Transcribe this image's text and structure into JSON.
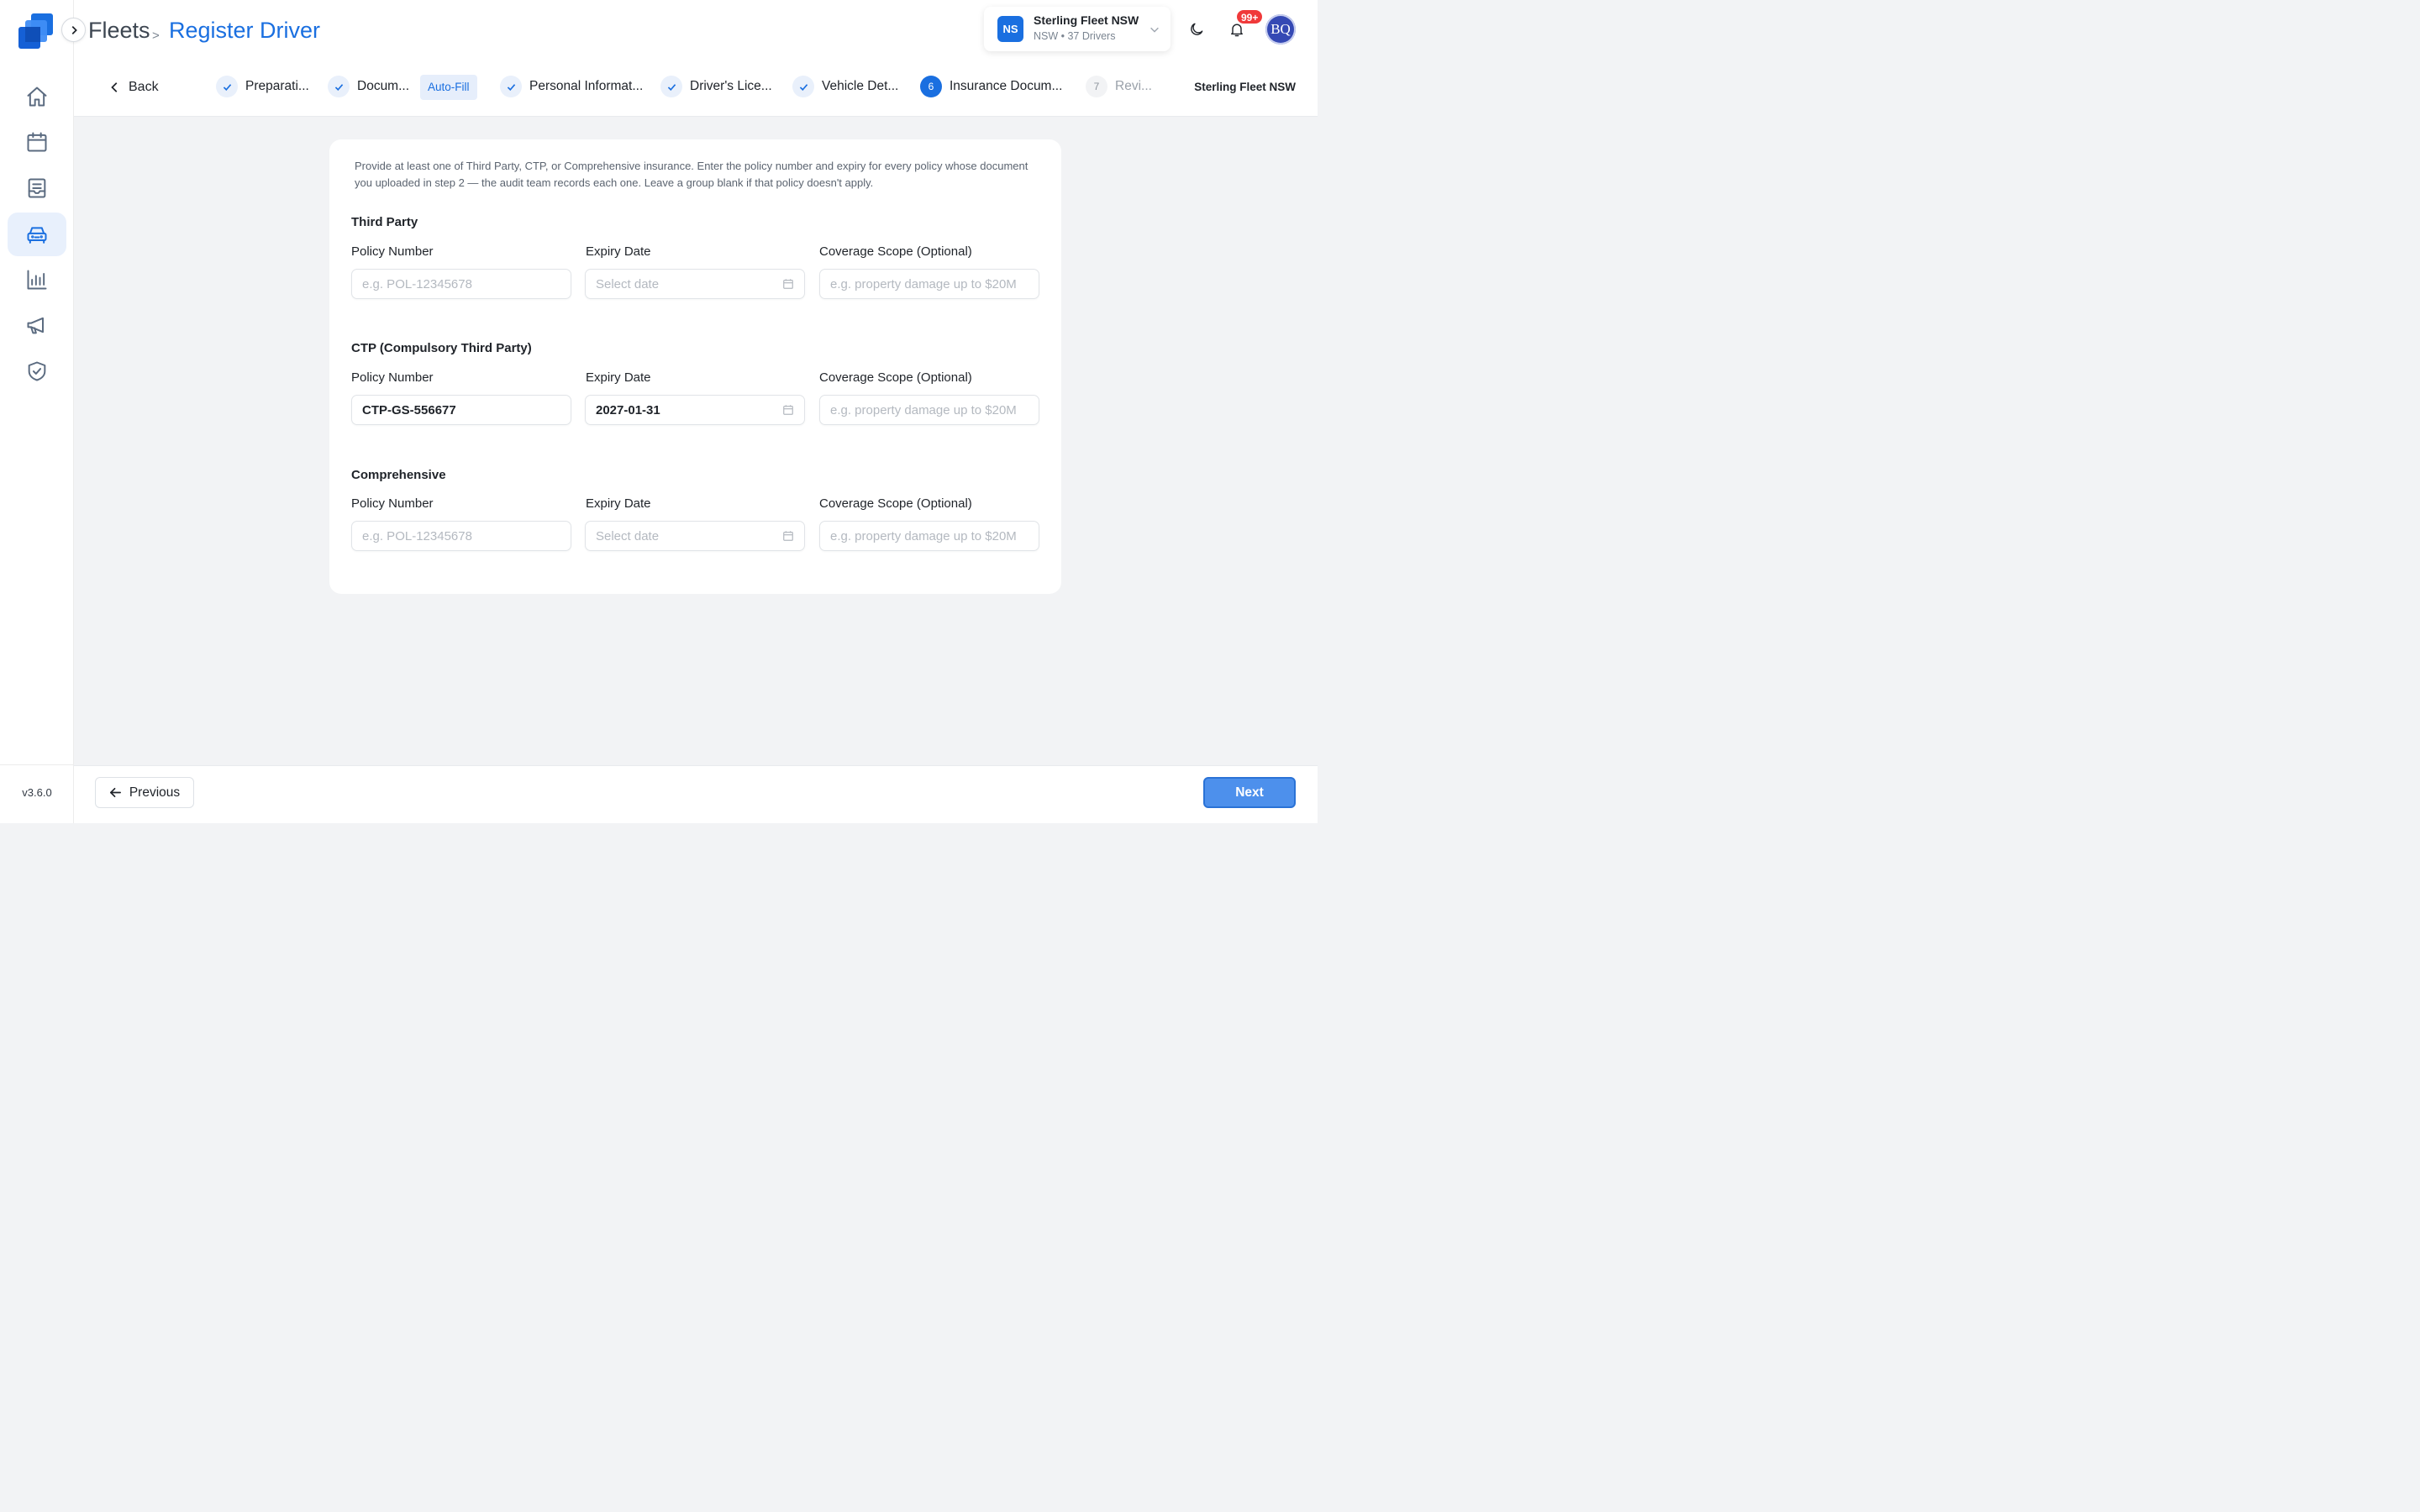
{
  "app": {
    "version": "v3.6.0",
    "accent_color": "#1a6fe0"
  },
  "sidebar": {
    "items": [
      {
        "name": "home",
        "icon": "home-icon",
        "active": false
      },
      {
        "name": "calendar",
        "icon": "calendar-icon",
        "active": false
      },
      {
        "name": "documents",
        "icon": "document-tray-icon",
        "active": false
      },
      {
        "name": "fleets",
        "icon": "car-icon",
        "active": true
      },
      {
        "name": "analytics",
        "icon": "bar-chart-icon",
        "active": false
      },
      {
        "name": "announcements",
        "icon": "megaphone-icon",
        "active": false
      },
      {
        "name": "compliance",
        "icon": "shield-check-icon",
        "active": false
      }
    ]
  },
  "header": {
    "breadcrumb_root": "Fleets",
    "breadcrumb_separator": ">",
    "breadcrumb_current": "Register Driver",
    "fleet_switcher": {
      "initials": "NS",
      "name": "Sterling Fleet NSW",
      "subtitle": "NSW • 37 Drivers"
    },
    "notifications_badge": "99+",
    "user_initials": "BQ"
  },
  "stepper": {
    "back_label": "Back",
    "autofill_label": "Auto-Fill",
    "fleet_label": "Sterling Fleet NSW",
    "steps": [
      {
        "number": "1",
        "label": "Preparati...",
        "state": "done"
      },
      {
        "number": "2",
        "label": "Docum...",
        "state": "done"
      },
      {
        "number": "3",
        "label": "Personal Informat...",
        "state": "done"
      },
      {
        "number": "4",
        "label": "Driver's Lice...",
        "state": "done"
      },
      {
        "number": "5",
        "label": "Vehicle Det...",
        "state": "done"
      },
      {
        "number": "6",
        "label": "Insurance Docum...",
        "state": "current"
      },
      {
        "number": "7",
        "label": "Revi...",
        "state": "pending"
      }
    ]
  },
  "form": {
    "intro": "Provide at least one of Third Party, CTP, or Comprehensive insurance. Enter the policy number and expiry for every policy whose document you uploaded in step 2 — the audit team records each one. Leave a group blank if that policy doesn't apply.",
    "labels": {
      "policy_number": "Policy Number",
      "expiry_date": "Expiry Date",
      "coverage_scope": "Coverage Scope (Optional)"
    },
    "placeholders": {
      "policy_number": "e.g. POL-12345678",
      "expiry_date": "Select date",
      "coverage_scope": "e.g. property damage up to $20M"
    },
    "groups": [
      {
        "title": "Third Party",
        "policy_number": "",
        "expiry_date": "",
        "coverage_scope": ""
      },
      {
        "title": "CTP (Compulsory Third Party)",
        "policy_number": "CTP-GS-556677",
        "expiry_date": "2027-01-31",
        "coverage_scope": ""
      },
      {
        "title": "Comprehensive",
        "policy_number": "",
        "expiry_date": "",
        "coverage_scope": ""
      }
    ]
  },
  "footer": {
    "previous_label": "Previous",
    "next_label": "Next"
  }
}
